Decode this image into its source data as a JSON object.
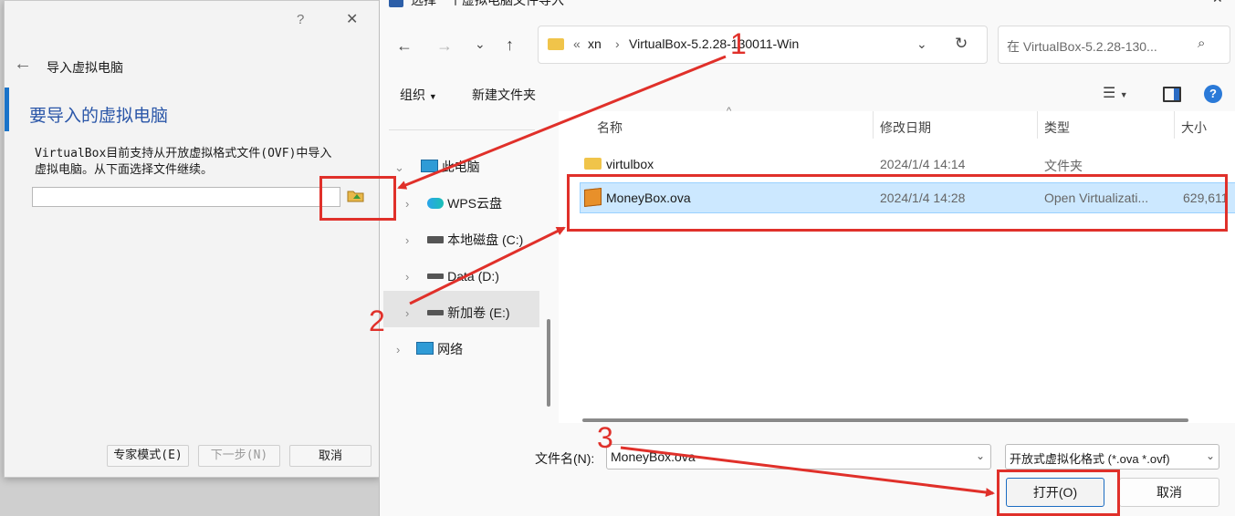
{
  "wizard": {
    "help": "?",
    "close": "✕",
    "back_arrow": "←",
    "title": "导入虚拟电脑",
    "heading": "要导入的虚拟电脑",
    "description_line1": "VirtualBox目前支持从开放虚拟格式文件(OVF)中导入",
    "description_line2": "虚拟电脑。从下面选择文件继续。",
    "file_value": "",
    "expert_button": "专家模式(E)",
    "next_button": "下一步(N)",
    "cancel_button": "取消"
  },
  "filedlg": {
    "title": "选择一个虚拟电脑文件导入",
    "address": {
      "chevrons": "«",
      "crumbs": [
        "xn",
        "VirtualBox-5.2.28-130011-Win"
      ],
      "search_placeholder": "在 VirtualBox-5.2.28-130..."
    },
    "toolbar": {
      "organize": "组织",
      "new_folder": "新建文件夹"
    },
    "nav": {
      "this_pc": "此电脑",
      "items": [
        "WPS云盘",
        "本地磁盘 (C:)",
        "Data (D:)",
        "新加卷 (E:)"
      ],
      "network": "网络"
    },
    "columns": {
      "name": "名称",
      "modified": "修改日期",
      "type": "类型",
      "size": "大小"
    },
    "files": [
      {
        "name": "virtulbox",
        "modified": "2024/1/4 14:14",
        "type": "文件夹",
        "size": ""
      },
      {
        "name": "MoneyBox.ova",
        "modified": "2024/1/4 14:28",
        "type": "Open Virtualizati...",
        "size": "629,611"
      }
    ],
    "filename_label": "文件名(N):",
    "filename_value": "MoneyBox.ova",
    "filter_value": "开放式虚拟化格式 (*.ova *.ovf)",
    "open_button": "打开(O)",
    "cancel_button": "取消"
  },
  "annotations": [
    "1",
    "2",
    "3"
  ],
  "colors": {
    "annotation": "#e0302a",
    "accent": "#1a73c9",
    "selection": "#cce8ff"
  }
}
